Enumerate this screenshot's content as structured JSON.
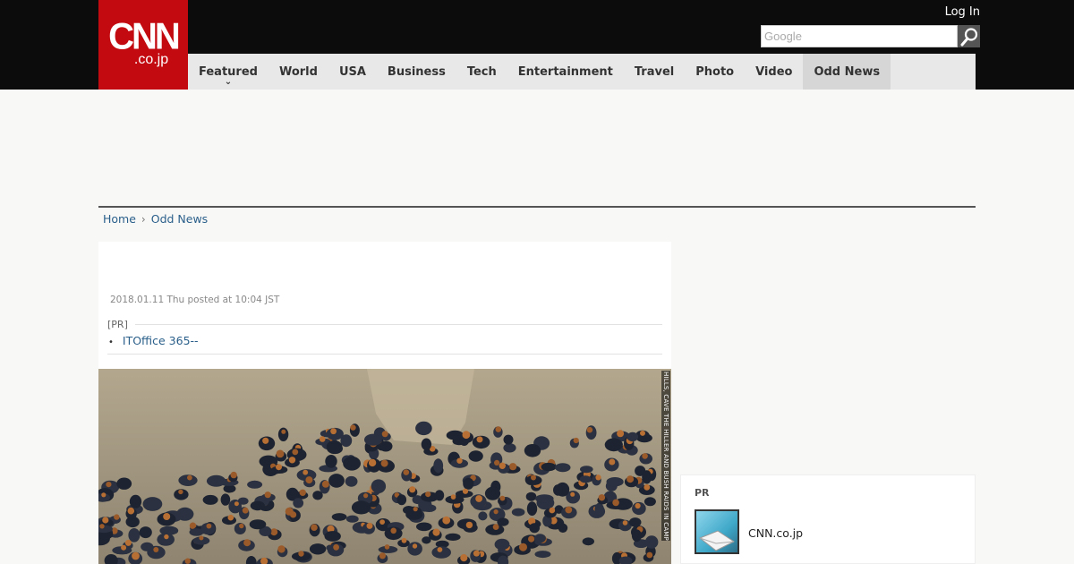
{
  "header": {
    "logo_main": "CNN",
    "logo_sub": ".co.jp",
    "login_label": "Log In",
    "search_placeholder": "Google"
  },
  "nav": {
    "items": [
      {
        "label": "Featured"
      },
      {
        "label": "World"
      },
      {
        "label": "USA"
      },
      {
        "label": "Business"
      },
      {
        "label": "Tech"
      },
      {
        "label": "Entertainment"
      },
      {
        "label": "Travel"
      },
      {
        "label": "Photo"
      },
      {
        "label": "Video"
      },
      {
        "label": "Odd News",
        "active": true
      }
    ]
  },
  "breadcrumb": {
    "home": "Home",
    "current": "Odd News"
  },
  "article": {
    "date": "2018.01.11 Thu posted at 10:04 JST",
    "pr_label": "[PR]",
    "pr_link": "ITOffice 365--",
    "photo_caption": "HILLS, CAVE THE HILLER AND BUSH RAIDS IN CAMPBELLTOWN"
  },
  "sidebar": {
    "pr_label": "PR",
    "item_name": "CNN.co.jp"
  },
  "colors": {
    "brand_red": "#c20a10",
    "topbar": "#0c0c0c",
    "link": "#2a5f8a"
  }
}
